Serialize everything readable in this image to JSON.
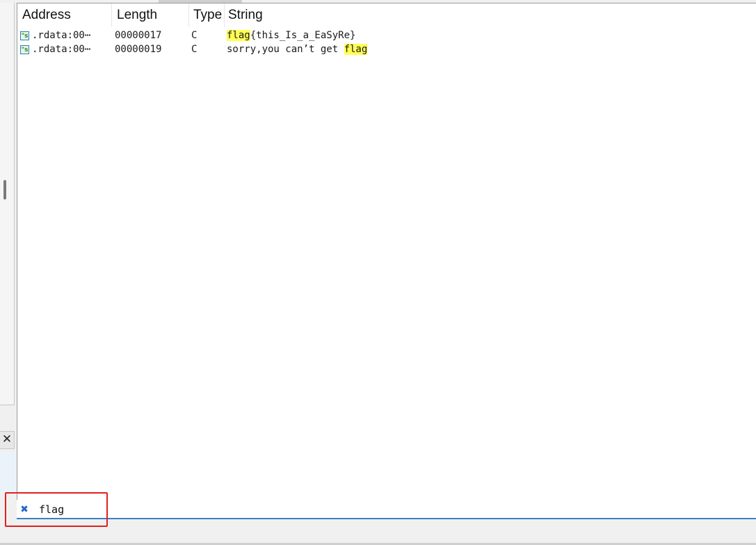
{
  "columns": {
    "address": "Address",
    "length": "Length",
    "type": "Type",
    "string": "String"
  },
  "rows": [
    {
      "address": ".rdata:00⋯",
      "length": "00000017",
      "type": "C",
      "string_match_before": "",
      "string_match": "flag",
      "string_after": "{this_Is_a_EaSyRe}"
    },
    {
      "address": ".rdata:00⋯",
      "length": "00000019",
      "type": "C",
      "string_match_before": "sorry,you can’t get ",
      "string_match": "flag",
      "string_after": ""
    }
  ],
  "filter": {
    "value": "flag"
  },
  "icons": {
    "string_row": "string-literal-icon",
    "clear_filter": "clear-filter-icon",
    "close": "close-icon"
  },
  "colors": {
    "match_highlight": "#ffff55",
    "annotation_box": "#e02020",
    "filter_underline": "#3c7fc4"
  }
}
